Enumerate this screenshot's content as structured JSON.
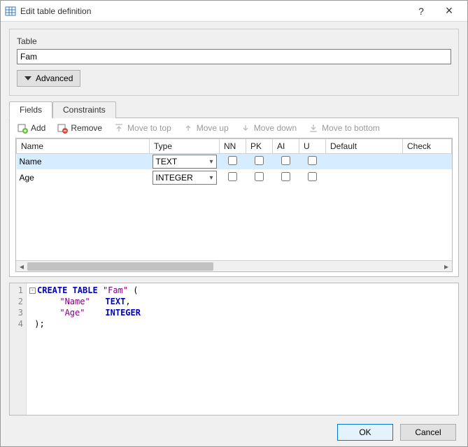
{
  "window": {
    "title": "Edit table definition",
    "help": "?",
    "close": "×"
  },
  "tableSection": {
    "label": "Table",
    "name": "Fam",
    "advanced": "Advanced"
  },
  "tabs": {
    "fields": "Fields",
    "constraints": "Constraints"
  },
  "toolbar": {
    "add": "Add",
    "remove": "Remove",
    "movetop": "Move to top",
    "moveup": "Move up",
    "movedown": "Move down",
    "movebottom": "Move to bottom"
  },
  "columns": {
    "name": "Name",
    "type": "Type",
    "nn": "NN",
    "pk": "PK",
    "ai": "AI",
    "u": "U",
    "default": "Default",
    "check": "Check"
  },
  "rows": [
    {
      "name": "Name",
      "type": "TEXT",
      "nn": false,
      "pk": false,
      "ai": false,
      "u": false,
      "default": "",
      "check": ""
    },
    {
      "name": "Age",
      "type": "INTEGER",
      "nn": false,
      "pk": false,
      "ai": false,
      "u": false,
      "default": "",
      "check": ""
    }
  ],
  "sql": {
    "ln1": "1",
    "ln2": "2",
    "ln3": "3",
    "ln4": "4",
    "create": "CREATE TABLE",
    "tablename": "\"Fam\"",
    "open": " (",
    "field1name": "\"Name\"",
    "field1type": "TEXT",
    "comma": ",",
    "field2name": "\"Age\"",
    "field2type": "INTEGER",
    "close": ");"
  },
  "buttons": {
    "ok": "OK",
    "cancel": "Cancel"
  }
}
